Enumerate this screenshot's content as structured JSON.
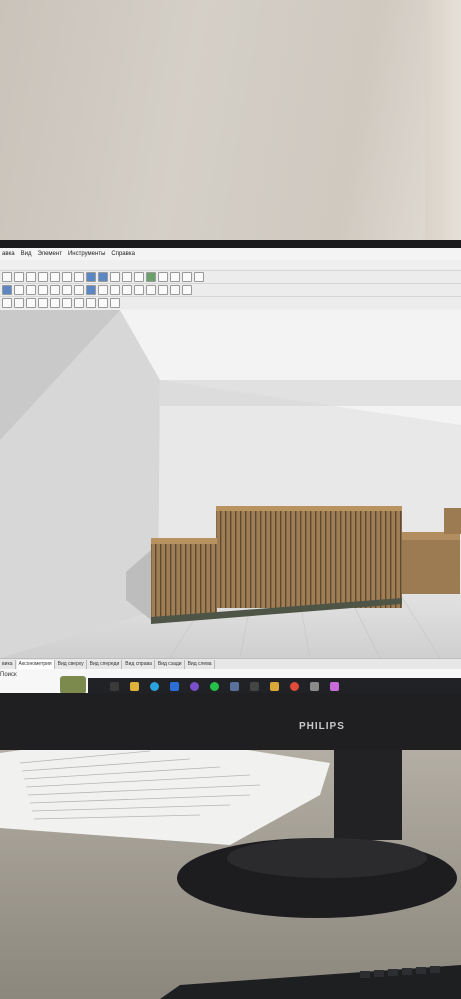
{
  "app": {
    "menu": [
      "авка",
      "Вид",
      "Элемент",
      "Инструменты",
      "Справка"
    ]
  },
  "view_tabs": [
    "вика",
    "Аксонометрия",
    "Вид сверху",
    "Вид спереди",
    "Вид справа",
    "Вид сзади",
    "Вид слева"
  ],
  "status": {
    "search_label": "Поиск"
  },
  "taskbar": {
    "icons": [
      "start-icon",
      "explorer-icon",
      "telegram-icon",
      "store-icon",
      "viber-icon",
      "whatsapp-icon",
      "app-icon",
      "terminal-icon",
      "folder-icon",
      "chrome-icon",
      "calculator-icon",
      "copilot-icon"
    ]
  },
  "monitor": {
    "brand": "PHILIPS"
  },
  "colors": {
    "wood": "#9c7a52",
    "slat_dark": "#5e4a31",
    "floor": "#d8d8d8",
    "taskbar": "#202226"
  }
}
